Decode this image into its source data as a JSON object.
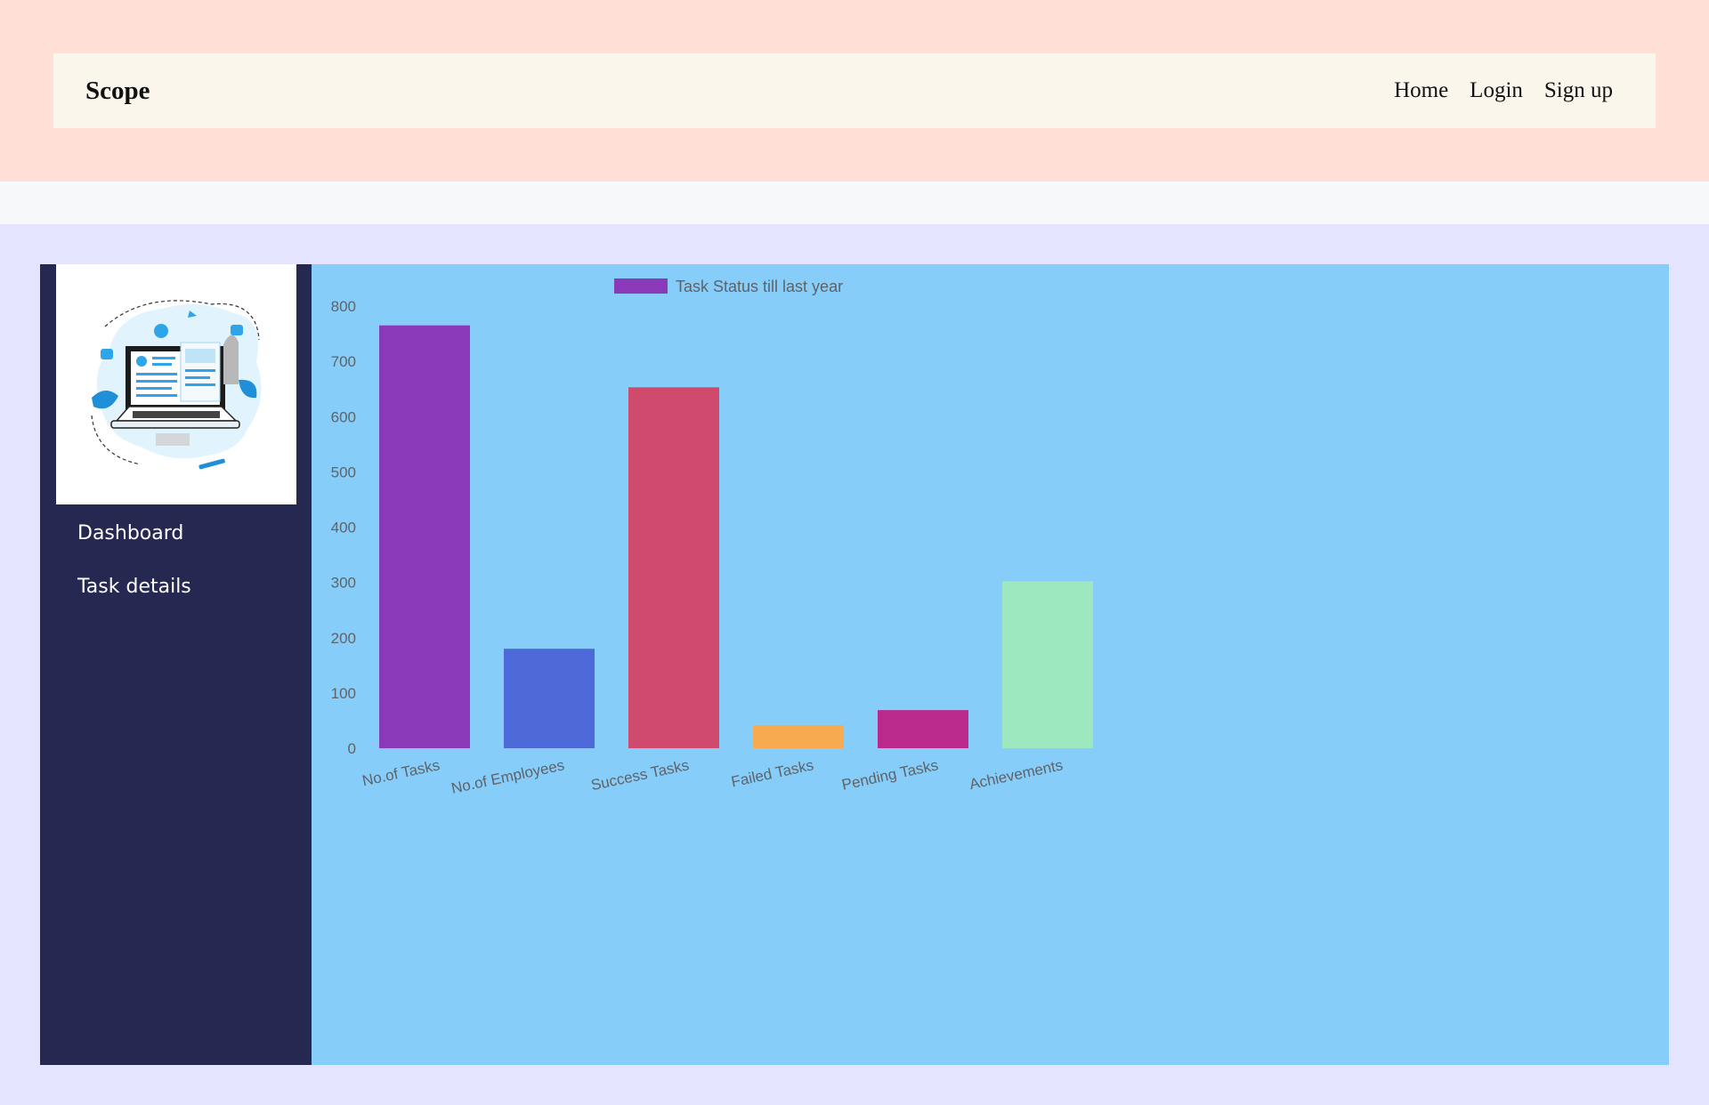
{
  "navbar": {
    "brand": "Scope",
    "links": [
      "Home",
      "Login",
      "Sign up"
    ]
  },
  "sidebar": {
    "logo_icon": "laptop-illustration-icon",
    "items": [
      {
        "label": "Dashboard"
      },
      {
        "label": "Task details"
      }
    ]
  },
  "colors": {
    "top_band": "#ffdfd6",
    "navbar": "#faf6ec",
    "main_band": "#e4e4ff",
    "sidebar": "#252850",
    "chart_panel": "#87cdf9"
  },
  "chart_data": {
    "type": "bar",
    "categories": [
      "No.of Tasks",
      "No.of Employees",
      "Success Tasks",
      "Failed Tasks",
      "Pending Tasks",
      "Achievements"
    ],
    "series": [
      {
        "name": "Task Status till last year",
        "values": [
          765,
          180,
          653,
          42,
          69,
          302
        ]
      }
    ],
    "bar_colors": [
      "#8a39b8",
      "#4d6ad8",
      "#cf4a6c",
      "#f8aa50",
      "#b92a8c",
      "#9ee8c0"
    ],
    "ylim": [
      0,
      800
    ],
    "yticks": [
      0,
      100,
      200,
      300,
      400,
      500,
      600,
      700,
      800
    ],
    "legend_position": "top",
    "grid": false
  }
}
